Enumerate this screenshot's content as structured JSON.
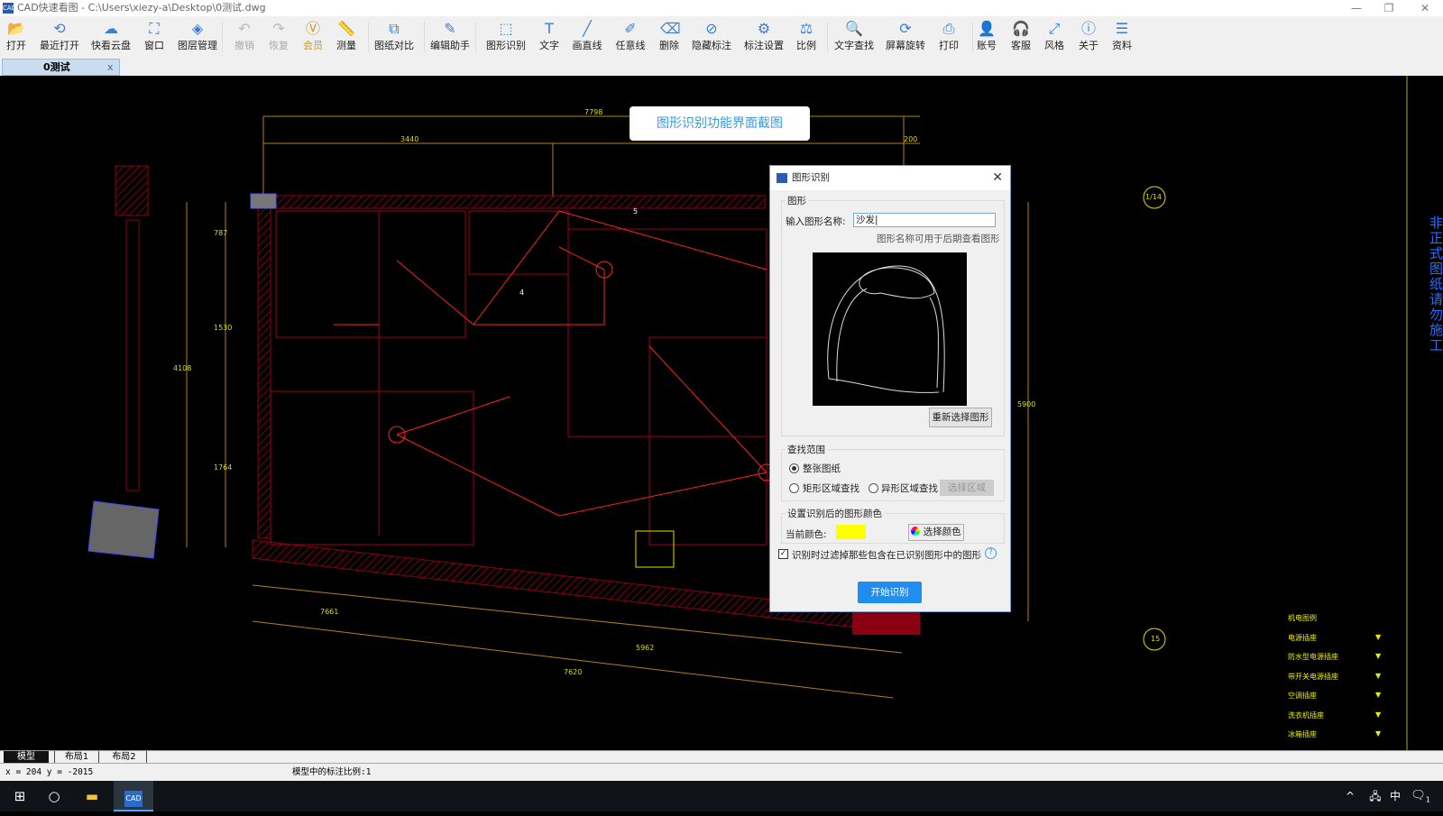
{
  "window": {
    "title": "CAD快速看图 - C:\\Users\\xiezy-a\\Desktop\\0测试.dwg",
    "logo": "CAD",
    "controls": [
      "—",
      "❐",
      "✕"
    ]
  },
  "toolbar": {
    "items": [
      {
        "label": "打开",
        "icon": "folder-open-icon",
        "glyph": "📂"
      },
      {
        "label": "最近打开",
        "icon": "history-icon",
        "glyph": "⟲"
      },
      {
        "label": "快看云盘",
        "icon": "cloud-icon",
        "glyph": "☁"
      },
      {
        "label": "窗口",
        "icon": "window-fit-icon",
        "glyph": "⛶"
      },
      {
        "label": "图层管理",
        "icon": "layers-icon",
        "glyph": "◈"
      },
      {
        "label": "撤销",
        "icon": "undo-icon",
        "glyph": "↶",
        "disabled": true
      },
      {
        "label": "恢复",
        "icon": "redo-icon",
        "glyph": "↷",
        "disabled": true
      },
      {
        "label": "会员",
        "icon": "vip-icon",
        "glyph": "Ⓥ",
        "vip": true
      },
      {
        "label": "测量",
        "icon": "ruler-icon",
        "glyph": "📏"
      },
      {
        "label": "图纸对比",
        "icon": "compare-icon",
        "glyph": "⧉"
      },
      {
        "label": "编辑助手",
        "icon": "edit-assistant-icon",
        "glyph": "✎"
      },
      {
        "label": "图形识别",
        "icon": "shape-recognition-icon",
        "glyph": "⬚"
      },
      {
        "label": "文字",
        "icon": "text-icon",
        "glyph": "T"
      },
      {
        "label": "画直线",
        "icon": "line-icon",
        "glyph": "╱"
      },
      {
        "label": "任意线",
        "icon": "pen-icon",
        "glyph": "✐"
      },
      {
        "label": "删除",
        "icon": "eraser-icon",
        "glyph": "⌫"
      },
      {
        "label": "隐藏标注",
        "icon": "hide-icon",
        "glyph": "⊘"
      },
      {
        "label": "标注设置",
        "icon": "annotation-settings-icon",
        "glyph": "⚙"
      },
      {
        "label": "比例",
        "icon": "scale-icon",
        "glyph": "⚖"
      },
      {
        "label": "文字查找",
        "icon": "text-search-icon",
        "glyph": "🔍"
      },
      {
        "label": "屏幕旋转",
        "icon": "rotate-icon",
        "glyph": "⟳"
      },
      {
        "label": "打印",
        "icon": "printer-icon",
        "glyph": "⎙"
      },
      {
        "label": "账号",
        "icon": "user-icon",
        "glyph": "👤"
      },
      {
        "label": "客服",
        "icon": "headset-icon",
        "glyph": "🎧"
      },
      {
        "label": "风格",
        "icon": "style-icon",
        "glyph": "⤢"
      },
      {
        "label": "关于",
        "icon": "info-icon",
        "glyph": "ⓘ"
      },
      {
        "label": "资料",
        "icon": "resources-icon",
        "glyph": "☰"
      }
    ]
  },
  "doc_tab": {
    "label": "0测试",
    "close": "x"
  },
  "canvas": {
    "banner": "图形识别功能界面截图",
    "dimensions": [
      "7798",
      "3440",
      "200",
      "787",
      "1530",
      "4108",
      "1764",
      "5900",
      "7661",
      "5962",
      "7620",
      "1/14",
      "15",
      "5",
      "4"
    ],
    "legend": [
      "机电图例",
      "电源插座",
      "防水型电源插座",
      "带开关电源插座",
      "空调插座",
      "洗衣机插座",
      "冰箱插座"
    ],
    "side_text": "非正式图纸请勿施工"
  },
  "dialog": {
    "title": "图形识别",
    "shape_group": "图形",
    "name_label": "输入图形名称:",
    "name_value": "沙发|",
    "hint": "图形名称可用于后期查看图形",
    "reselect": "重新选择图形",
    "range_group": "查找范围",
    "range_options": [
      {
        "label": "整张图纸",
        "checked": true
      },
      {
        "label": "矩形区域查找",
        "checked": false
      },
      {
        "label": "异形区域查找",
        "checked": false
      }
    ],
    "select_area": "选择区域",
    "color_group": "设置识别后的图形颜色",
    "current_color_label": "当前颜色:",
    "current_color": "#ffff00",
    "choose_color": "选择颜色",
    "filter_label": "识别时过滤掉那些包含在已识别图形中的图形",
    "filter_checked": true,
    "help": "?",
    "start": "开始识别"
  },
  "layout_tabs": [
    "模型",
    "布局1",
    "布局2"
  ],
  "status": {
    "coords": "x = 204  y = -2015",
    "scale": "模型中的标注比例:1"
  },
  "taskbar": {
    "tray": [
      "^",
      "中"
    ],
    "notification_count": "1"
  },
  "colors": {
    "accent": "#1e8ff0",
    "cad_red": "#ff2a2a",
    "cad_yellow": "#e0e000",
    "wall": "#8b0010"
  }
}
